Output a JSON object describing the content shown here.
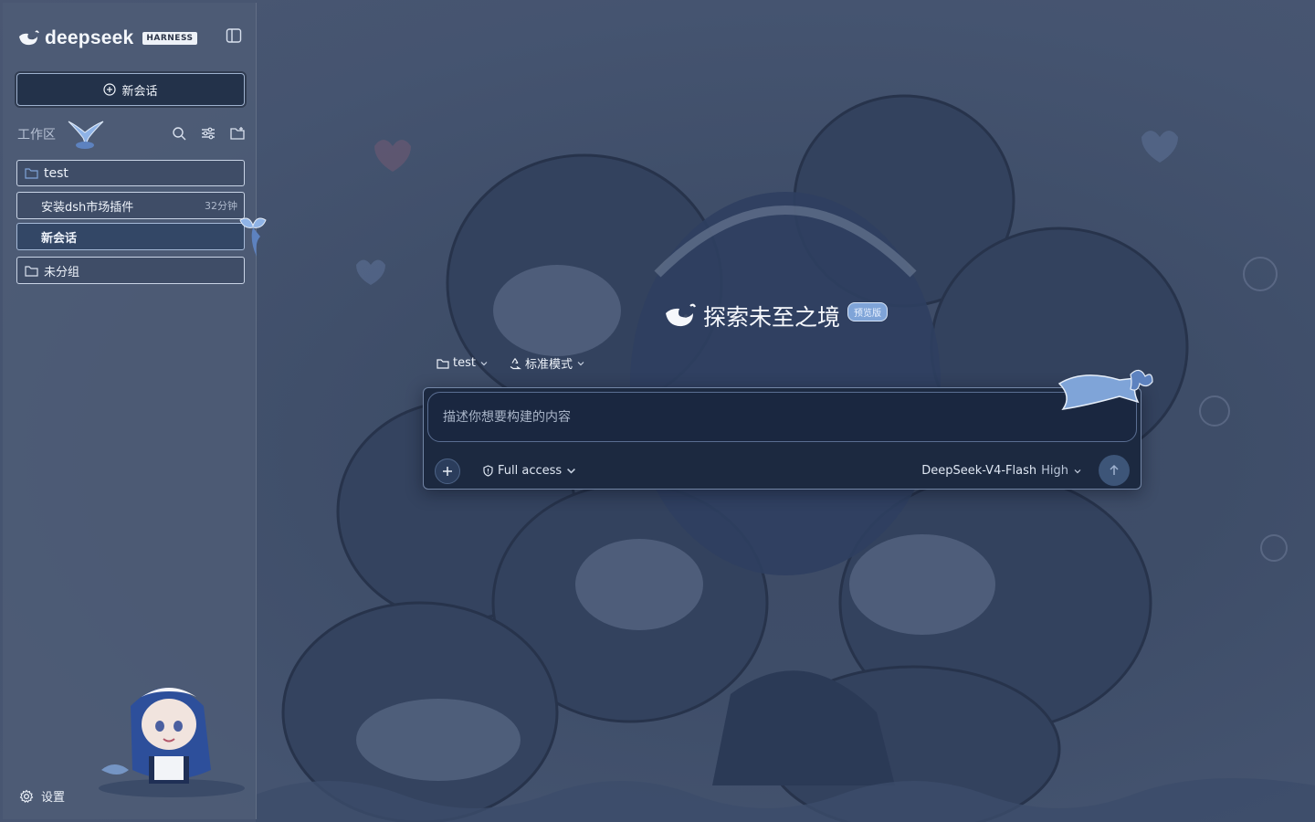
{
  "app": {
    "brand_name": "deepseek",
    "brand_tag": "HARNESS"
  },
  "sidebar": {
    "new_chat_label": "新会话",
    "workspace_label": "工作区",
    "items": [
      {
        "label": "test",
        "type": "folder"
      },
      {
        "label": "安装dsh市场插件",
        "time": "32分钟"
      },
      {
        "label": "新会话",
        "active": true
      },
      {
        "label": "未分组",
        "type": "folder"
      }
    ],
    "settings_label": "设置"
  },
  "main": {
    "hero_title": "探索未至之境",
    "hero_badge": "预览版",
    "project_selector": "test",
    "mode_selector": "标准模式",
    "composer": {
      "placeholder": "描述你想要构建的内容",
      "access_label": "Full access",
      "model_name": "DeepSeek-V4-Flash",
      "model_level": "High"
    }
  },
  "colors": {
    "background": "#46546b",
    "sidebar": "#4e5c76",
    "composer": "#1c2940",
    "accent": "#7fa4d8"
  }
}
